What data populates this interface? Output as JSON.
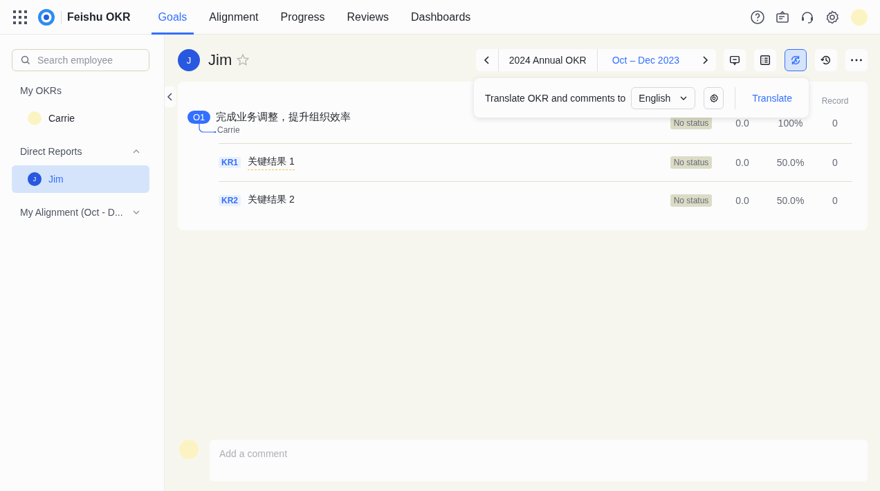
{
  "app": {
    "name": "Feishu OKR"
  },
  "nav_tabs": [
    {
      "label": "Goals",
      "selected": true
    },
    {
      "label": "Alignment",
      "selected": false
    },
    {
      "label": "Progress",
      "selected": false
    },
    {
      "label": "Reviews",
      "selected": false
    },
    {
      "label": "Dashboards",
      "selected": false
    }
  ],
  "sidebar": {
    "search": {
      "placeholder": "Search employee"
    },
    "sections": [
      {
        "title": "My OKRs",
        "items": [
          {
            "name": "Carrie",
            "selected": false
          }
        ]
      },
      {
        "title": "Direct Reports",
        "expanded": true,
        "items": [
          {
            "name": "Jim",
            "letter": "J",
            "selected": true
          }
        ]
      },
      {
        "title": "My Alignment (Oct - D...",
        "expanded": false
      }
    ]
  },
  "header": {
    "avatar_letter": "J",
    "name": "Jim",
    "starred": false,
    "period_nav": [
      {
        "label": "2024 Annual OKR",
        "selected": false
      },
      {
        "label": "Oct – Dec 2023",
        "selected": true
      }
    ],
    "tools": [
      {
        "kind": "comment",
        "active": false
      },
      {
        "kind": "list",
        "active": false
      },
      {
        "kind": "translate",
        "active": true
      },
      {
        "kind": "history",
        "active": false
      },
      {
        "kind": "more",
        "active": false
      }
    ]
  },
  "translate_popover": {
    "label": "Translate OKR and comments to",
    "language": "English",
    "action": "Translate"
  },
  "okr": {
    "column_header": "Record",
    "objective": {
      "tag": "O1",
      "title": "完成业务调整，提升组织效率",
      "owner": "Carrie",
      "status": "No status",
      "score": "0.0",
      "progress": "100%",
      "record": "0"
    },
    "key_results": [
      {
        "tag": "KR1",
        "title": "关键结果 1",
        "highlighted": true,
        "status": "No status",
        "score": "0.0",
        "progress": "50.0%",
        "record": "0"
      },
      {
        "tag": "KR2",
        "title": "关键结果 2",
        "highlighted": false,
        "status": "No status",
        "score": "0.0",
        "progress": "50.0%",
        "record": "0"
      }
    ]
  },
  "comment": {
    "placeholder": "Add a comment"
  }
}
